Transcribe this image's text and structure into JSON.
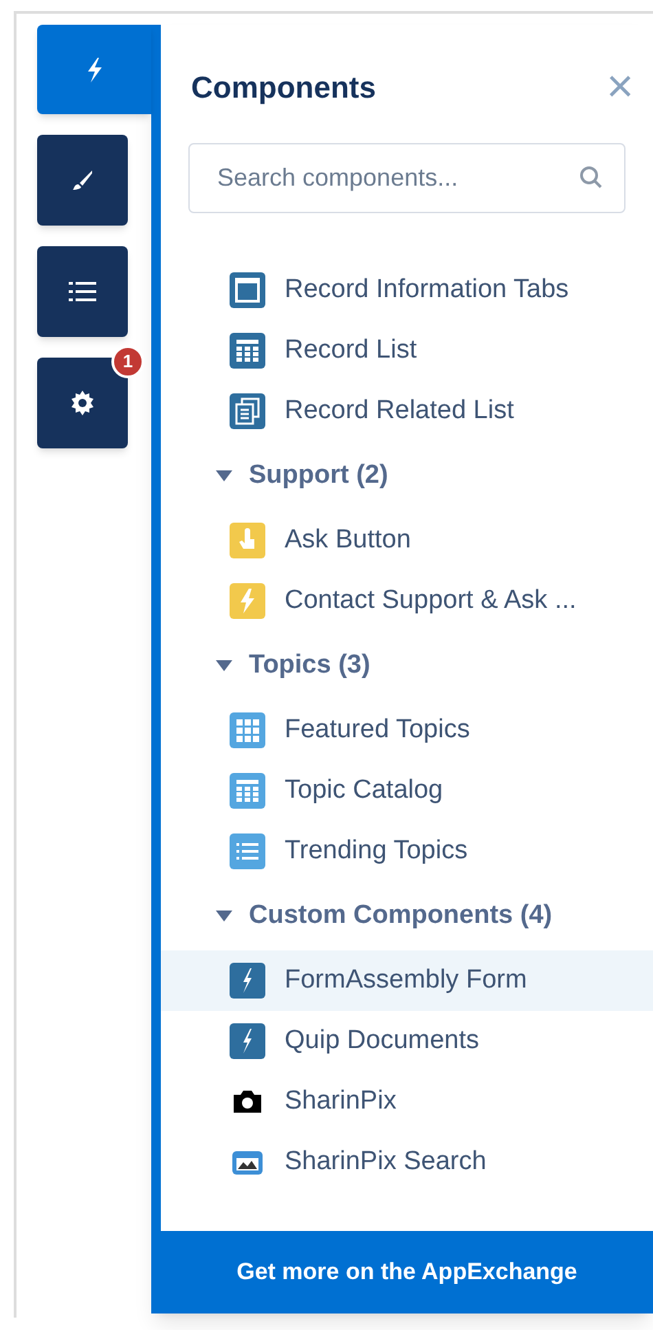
{
  "sidebar": {
    "tabs": [
      {
        "kind": "bolt",
        "selected": true
      },
      {
        "kind": "brush",
        "selected": false
      },
      {
        "kind": "list",
        "selected": false
      },
      {
        "kind": "gear",
        "selected": false,
        "badge": "1"
      }
    ]
  },
  "panel": {
    "title": "Components",
    "close": "×",
    "search": {
      "placeholder": "Search components..."
    },
    "items": [
      {
        "kind": "tabs",
        "label": "Record Information Tabs",
        "color": "#2e6e9e",
        "selected": false
      },
      {
        "kind": "table",
        "label": "Record List",
        "color": "#2e6e9e",
        "selected": false
      },
      {
        "kind": "related",
        "label": "Record Related List",
        "color": "#2e6e9e",
        "selected": false
      }
    ],
    "sections": [
      {
        "title": "Support (2)",
        "expanded": true,
        "items": [
          {
            "kind": "touch",
            "label": "Ask Button",
            "color": "#f2c94c",
            "selected": false
          },
          {
            "kind": "bolt",
            "label": "Contact Support & Ask ...",
            "color": "#f2c94c",
            "selected": false
          }
        ]
      },
      {
        "title": "Topics (3)",
        "expanded": true,
        "items": [
          {
            "kind": "grid",
            "label": "Featured Topics",
            "color": "#54a6e0",
            "selected": false
          },
          {
            "kind": "table",
            "label": "Topic Catalog",
            "color": "#54a6e0",
            "selected": false
          },
          {
            "kind": "list",
            "label": "Trending Topics",
            "color": "#54a6e0",
            "selected": false
          }
        ]
      },
      {
        "title": "Custom Components (4)",
        "expanded": true,
        "items": [
          {
            "kind": "custom",
            "label": "FormAssembly Form",
            "color": "#2e6e9e",
            "selected": true
          },
          {
            "kind": "custom",
            "label": "Quip Documents",
            "color": "#2e6e9e",
            "selected": false
          },
          {
            "kind": "camera",
            "label": "SharinPix",
            "color": "#000000",
            "selected": false
          },
          {
            "kind": "image",
            "label": "SharinPix Search",
            "color": "#3d8fd6",
            "selected": false
          }
        ]
      }
    ],
    "footer": "Get more on the AppExchange"
  }
}
